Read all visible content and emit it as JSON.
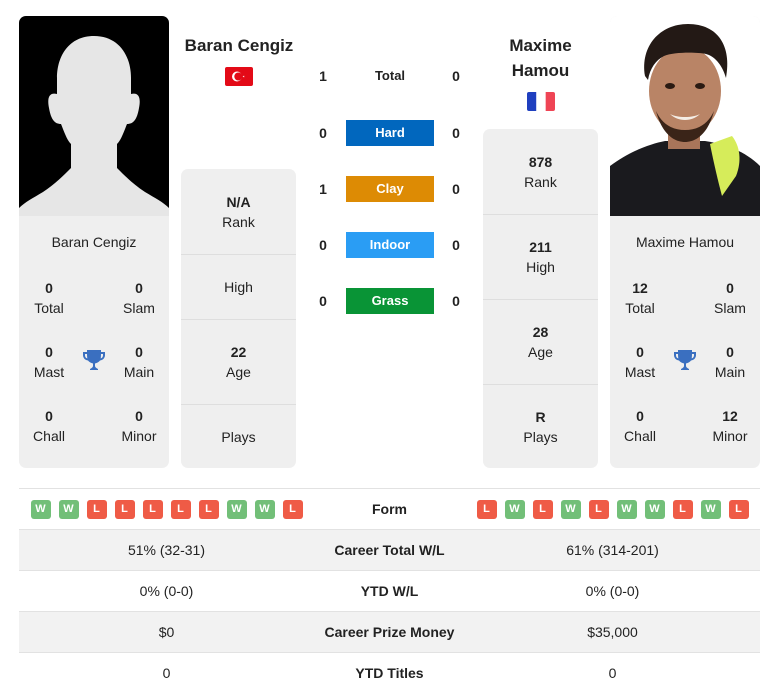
{
  "colors": {
    "hard": "#0167be",
    "clay": "#dd8b04",
    "indoor": "#2a9df4",
    "grass": "#099436",
    "win": "#72bf78",
    "loss": "#ef5b46",
    "trophy": "#3a6fc0"
  },
  "player1": {
    "name": "Baran Cengiz",
    "country_flag": "turkey-flag",
    "photo": "silhouette-placeholder",
    "titles": {
      "total": {
        "value": "0",
        "label": "Total"
      },
      "slam": {
        "value": "0",
        "label": "Slam"
      },
      "mast": {
        "value": "0",
        "label": "Mast"
      },
      "main": {
        "value": "0",
        "label": "Main"
      },
      "chall": {
        "value": "0",
        "label": "Chall"
      },
      "minor": {
        "value": "0",
        "label": "Minor"
      }
    },
    "info": {
      "rank": {
        "value": "N/A",
        "label": "Rank"
      },
      "high": {
        "value": "",
        "label": "High"
      },
      "age": {
        "value": "22",
        "label": "Age"
      },
      "plays": {
        "value": "",
        "label": "Plays"
      }
    },
    "form": [
      "W",
      "W",
      "L",
      "L",
      "L",
      "L",
      "L",
      "W",
      "W",
      "L"
    ],
    "career_wl": "51% (32-31)",
    "ytd_wl": "0% (0-0)",
    "prize_money": "$0",
    "ytd_titles": "0"
  },
  "player2": {
    "name_line1": "Maxime",
    "name_line2": "Hamou",
    "name": "Maxime Hamou",
    "country_flag": "france-flag",
    "photo": "player-photo",
    "titles": {
      "total": {
        "value": "12",
        "label": "Total"
      },
      "slam": {
        "value": "0",
        "label": "Slam"
      },
      "mast": {
        "value": "0",
        "label": "Mast"
      },
      "main": {
        "value": "0",
        "label": "Main"
      },
      "chall": {
        "value": "0",
        "label": "Chall"
      },
      "minor": {
        "value": "12",
        "label": "Minor"
      }
    },
    "info": {
      "rank": {
        "value": "878",
        "label": "Rank"
      },
      "high": {
        "value": "211",
        "label": "High"
      },
      "age": {
        "value": "28",
        "label": "Age"
      },
      "plays": {
        "value": "R",
        "label": "Plays"
      }
    },
    "form": [
      "L",
      "W",
      "L",
      "W",
      "L",
      "W",
      "W",
      "L",
      "W",
      "L"
    ],
    "career_wl": "61% (314-201)",
    "ytd_wl": "0% (0-0)",
    "prize_money": "$35,000",
    "ytd_titles": "0"
  },
  "h2h": [
    {
      "label": "Total",
      "p1": "1",
      "p2": "0",
      "surface": "total"
    },
    {
      "label": "Hard",
      "p1": "0",
      "p2": "0",
      "surface": "hard"
    },
    {
      "label": "Clay",
      "p1": "1",
      "p2": "0",
      "surface": "clay"
    },
    {
      "label": "Indoor",
      "p1": "0",
      "p2": "0",
      "surface": "indoor"
    },
    {
      "label": "Grass",
      "p1": "0",
      "p2": "0",
      "surface": "grass"
    }
  ],
  "table_labels": {
    "form": "Form",
    "career_wl": "Career Total W/L",
    "ytd_wl": "YTD W/L",
    "prize_money": "Career Prize Money",
    "ytd_titles": "YTD Titles"
  }
}
